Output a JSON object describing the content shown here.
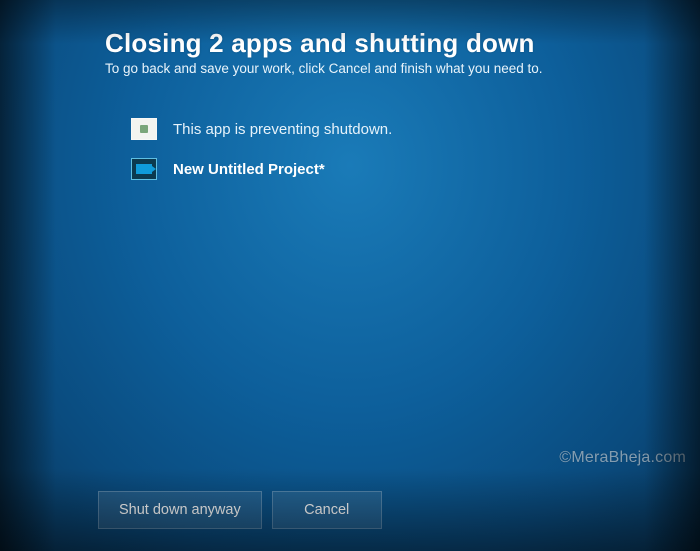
{
  "header": {
    "title": "Closing 2 apps and shutting down",
    "subtitle": "To go back and save your work, click Cancel and finish what you need to."
  },
  "apps": [
    {
      "icon": "generic-app-icon",
      "message": "This app is preventing shutdown.",
      "emphasis": false
    },
    {
      "icon": "video-app-icon",
      "message": "New Untitled Project*",
      "emphasis": true
    }
  ],
  "buttons": {
    "shutdown_anyway": "Shut down anyway",
    "cancel": "Cancel"
  },
  "watermark": "©MeraBheja.com"
}
